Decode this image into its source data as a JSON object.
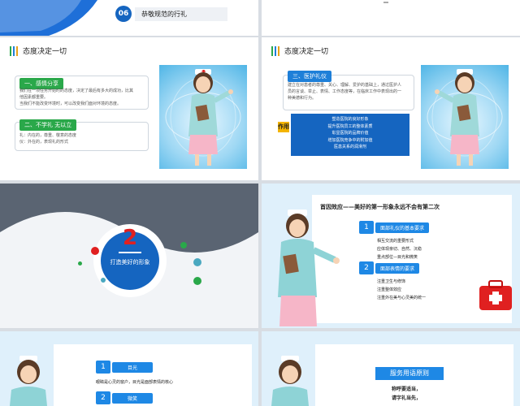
{
  "slide1": {
    "number": "06",
    "item_text": "恭敬规范的行礼"
  },
  "slide3": {
    "header": "态度决定一切",
    "tag1": "一、感情分享",
    "text1_lines": [
      "我们在一项任务开始时的态度，决定了最后有多大的成功，比其",
      "他因素都重要。",
      "当我们不能改变环境时，可以改变我们面对环境的态度。"
    ],
    "tag2": "二、不学礼 无以立",
    "text2_lines": [
      "礼：内在的，尊重、敬意的态度",
      "仪：外在的，表现礼的形式"
    ]
  },
  "slide4": {
    "header": "态度决定一切",
    "tag": "三、医护礼仪",
    "text_lines": [
      "建立在对患者的尊重、关心、理解、爱护的基础上，通过医护人",
      "员的言谈、举止、表情、工作态度等，在临床工作中表现出的一",
      "种美德和行为。"
    ],
    "use_label": "作用",
    "list": [
      "塑造医院的良好形象",
      "提升医院员工的整体素质",
      "彰显医院的品牌价值",
      "增加医院竞争中的附加值",
      "医患关系的润滑剂"
    ]
  },
  "slide5": {
    "number": "2",
    "title": "打造美好的形象"
  },
  "slide6": {
    "title": "首因效应——美好的第一形象永远不会有第二次",
    "sec1_num": "1",
    "sec1_label": "面部礼仪的基本要求",
    "sec1_items": [
      "相互交流的重要形式",
      "应体现亲切、自然、沉稳",
      "重点部位—目光和微笑"
    ],
    "sec2_num": "2",
    "sec2_label": "面部表情的要求",
    "sec2_items": [
      "注重卫生与修饰",
      "注重整体效应",
      "注重外在美与心灵美的统一"
    ]
  },
  "slide7": {
    "sec1_num": "1",
    "sec1_label": "目光",
    "sec1_text": "眼睛是心灵的窗户，目光是面部表情的核心",
    "sec2_num": "2",
    "sec2_label": "微笑"
  },
  "slide8": {
    "title": "服务用语原则",
    "lines": [
      "称呼要适当，",
      "请字礼当先，"
    ]
  },
  "colors": {
    "green": "#2aa84a",
    "blue": "#1e7fd8",
    "red": "#e02020",
    "yellow": "#f4b400"
  }
}
